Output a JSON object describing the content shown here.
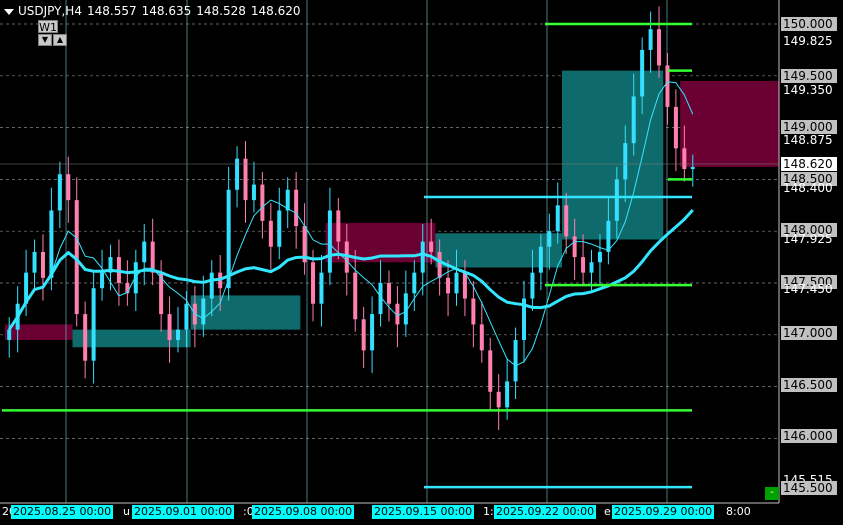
{
  "header": {
    "symbol": "USDJPY,H4",
    "open": "148.557",
    "high": "148.635",
    "low": "148.528",
    "close": "148.620"
  },
  "timeframe": {
    "label": "W1",
    "down_icon": "triangle-down-icon",
    "up_icon": "triangle-up-icon"
  },
  "price_axis": {
    "boxed_labels": [
      "150.000",
      "149.500",
      "149.000",
      "148.000",
      "147.500",
      "147.000",
      "146.500",
      "146.000",
      "145.500",
      "148.500"
    ],
    "plain_labels": [
      "149.825",
      "149.350",
      "148.875",
      "148.400",
      "147.925",
      "147.450",
      "145.515"
    ],
    "current_price": "148.620"
  },
  "time_axis": {
    "labels": [
      "2025.08.25 00:00",
      "2025.09.01 00:00",
      "2025.09.08 00:00",
      "2025.09.15 00:00",
      "2025.09.22 00:00",
      "2025.09.29 00:00"
    ],
    "fragments": [
      "20",
      "u",
      ":0",
      "1:",
      "e",
      "8:00"
    ]
  },
  "colors": {
    "background": "#000000",
    "bull": "#33e0ff",
    "bear": "#ff7fb0",
    "teal_zone": "#0f6b6b",
    "maroon_zone": "#6b0033",
    "green_line": "#33ff33",
    "cyan_line": "#33e6ff",
    "grid": "#b0b0b0"
  },
  "chart_data": {
    "type": "candlestick",
    "instrument": "USDJPY",
    "period": "H4",
    "ylim": [
      145.45,
      150.1
    ],
    "close": [
      147.05,
      147.3,
      147.6,
      147.8,
      147.55,
      148.2,
      148.55,
      148.3,
      147.2,
      146.75,
      147.45,
      147.6,
      147.75,
      147.5,
      147.4,
      147.7,
      147.9,
      147.6,
      147.2,
      146.95,
      147.05,
      147.3,
      147.1,
      147.35,
      147.6,
      147.45,
      148.4,
      148.7,
      148.3,
      148.45,
      148.1,
      147.85,
      148.2,
      148.4,
      148.05,
      147.7,
      147.3,
      147.6,
      148.2,
      147.9,
      147.6,
      147.15,
      146.85,
      147.2,
      147.5,
      147.3,
      147.1,
      147.4,
      147.6,
      147.9,
      147.8,
      147.55,
      147.4,
      147.6,
      147.35,
      147.1,
      146.85,
      146.45,
      146.3,
      146.55,
      146.95,
      147.35,
      147.6,
      147.85,
      148.0,
      148.25,
      147.95,
      147.75,
      147.6,
      147.7,
      147.8,
      148.1,
      148.5,
      148.85,
      149.3,
      149.75,
      149.95,
      149.6,
      149.2,
      148.8,
      148.6,
      148.62
    ],
    "horizontal_levels": [
      150.0,
      149.55,
      148.5,
      148.33,
      147.48,
      146.27,
      145.53
    ],
    "teal_zones": [
      {
        "from_index": 8,
        "to_index": 22,
        "low": 146.88,
        "high": 147.05
      },
      {
        "from_index": 22,
        "to_index": 35,
        "low": 147.05,
        "high": 147.38
      },
      {
        "from_index": 51,
        "to_index": 66,
        "low": 147.65,
        "high": 147.98
      },
      {
        "from_index": 66,
        "to_index": 78,
        "low": 147.92,
        "high": 149.55
      }
    ],
    "maroon_zones": [
      {
        "from_index": 0,
        "to_index": 8,
        "low": 146.95,
        "high": 147.1
      },
      {
        "from_index": 38,
        "to_index": 51,
        "low": 147.7,
        "high": 148.08
      },
      {
        "from_index": 80,
        "to_index": 95,
        "low": 148.62,
        "high": 149.45
      }
    ]
  }
}
